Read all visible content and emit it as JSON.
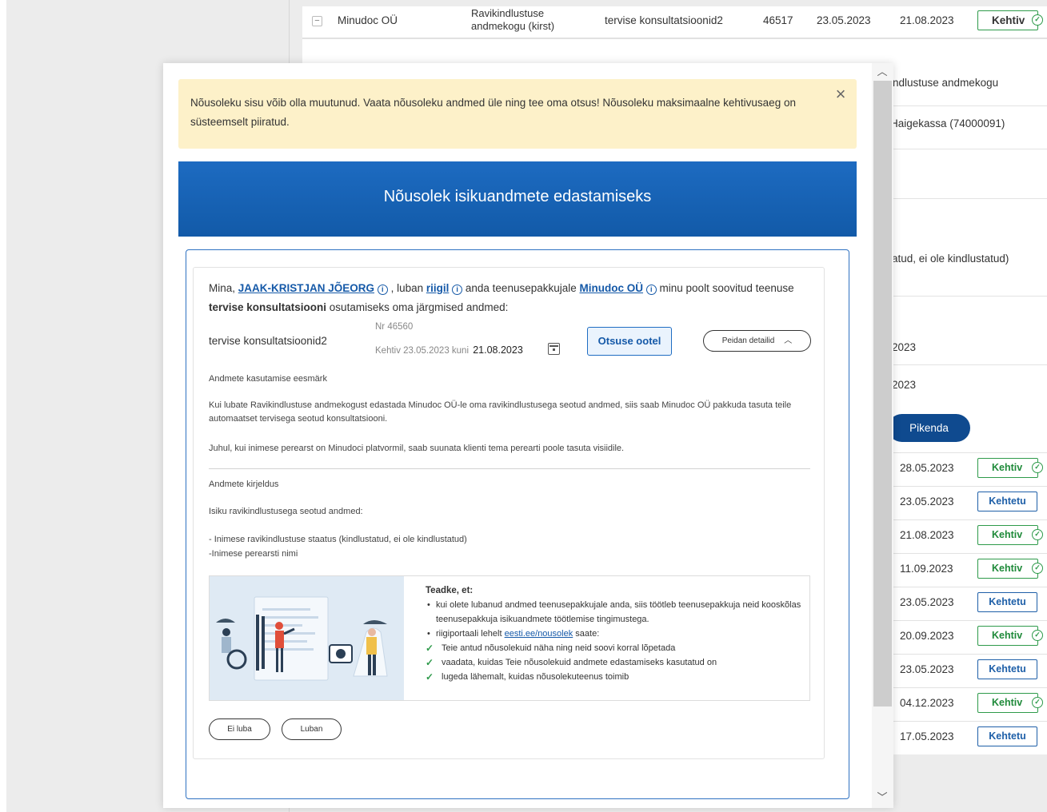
{
  "background": {
    "top_row": {
      "provider": "Minudoc OÜ",
      "source": "Ravikindlustuse andmekogu (kirst)",
      "service": "tervise konsultatsioonid2",
      "number": "46517",
      "start": "23.05.2023",
      "end": "21.08.2023",
      "status": "Kehtiv"
    },
    "detail_fragments": [
      "ndlustuse andmekogu",
      "Haigekassa (74000091)",
      "atud, ei ole kindlustatud)",
      "2023",
      "2023"
    ],
    "extend_label": "Pikenda",
    "rows": [
      {
        "date": "28.05.2023",
        "status": "Kehtiv"
      },
      {
        "date": "23.05.2023",
        "status": "Kehtetu"
      },
      {
        "date": "21.08.2023",
        "status": "Kehtiv"
      },
      {
        "date": "11.09.2023",
        "status": "Kehtiv"
      },
      {
        "date": "23.05.2023",
        "status": "Kehtetu"
      },
      {
        "date": "20.09.2023",
        "status": "Kehtiv"
      },
      {
        "date": "23.05.2023",
        "status": "Kehtetu"
      },
      {
        "date": "04.12.2023",
        "status": "Kehtiv"
      },
      {
        "date": "17.05.2023",
        "status": "Kehtetu"
      }
    ]
  },
  "modal": {
    "alert": "Nõusoleku sisu võib olla muutunud. Vaata nõusoleku andmed üle ning tee oma otsus! Nõusoleku maksimaalne kehtivusaeg on süsteemselt piiratud.",
    "title": "Nõusolek isikuandmete edastamiseks",
    "intro": {
      "p1": "Mina, ",
      "person": "JAAK-KRISTJAN JÕEORG",
      "p2": " , luban ",
      "recipient": "riigil",
      "p3": " anda teenusepakkujale ",
      "provider": "Minudoc OÜ",
      "p4": " minu poolt soovitud teenuse ",
      "service": "tervise konsultatsiooni",
      "p5": " osutamiseks oma järgmised andmed:"
    },
    "consent": {
      "name": "tervise konsultatsioonid2",
      "nr": "Nr 46560",
      "valid_prefix": "Kehtiv 23.05.2023 kuni",
      "valid_end": "21.08.2023",
      "status": "Otsuse ootel",
      "toggle": "Peidan detailid"
    },
    "purpose_heading": "Andmete kasutamise eesmärk",
    "purpose_1": "Kui lubate Ravikindlustuse andmekogust edastada Minudoc OÜ-le oma ravikindlustusega seotud andmed, siis saab Minudoc OÜ pakkuda tasuta teile automaatset tervisega seotud konsultatsiooni.",
    "purpose_2": "Juhul, kui inimese perearst on Minudoci platvormil, saab suunata klienti tema perearti poole tasuta visiidile.",
    "desc_heading": "Andmete kirjeldus",
    "desc_1": "Isiku ravikindlustusega seotud andmed:",
    "desc_2": "- Inimese ravikindlustuse staatus (kindlustatud, ei ole kindlustatud)",
    "desc_3": "-Inimese perearsti nimi",
    "info": {
      "heading": "Teadke, et:",
      "bullet_1": "kui olete lubanud andmed teenusepakkujale anda, siis töötleb teenusepakkuja neid kooskõlas teenusepakkuja isikuandmete töötlemise tingimustega.",
      "bullet_2_pre": "riigiportaali lehelt ",
      "bullet_2_link": "eesti.ee/nousolek",
      "bullet_2_post": " saate:",
      "check_1": "Teie antud nõusolekuid näha ning neid soovi korral lõpetada",
      "check_2": "vaadata, kuidas Teie nõusolekuid andmete edastamiseks kasutatud on",
      "check_3": "lugeda lähemalt, kuidas nõusolekuteenus toimib"
    },
    "decline": "Ei luba",
    "accept": "Luban"
  },
  "colors": {
    "brand_blue": "#125aa8",
    "link_blue": "#1559a8",
    "valid_green": "#2e9a4a",
    "alert_yellow": "#fdf1c9"
  }
}
